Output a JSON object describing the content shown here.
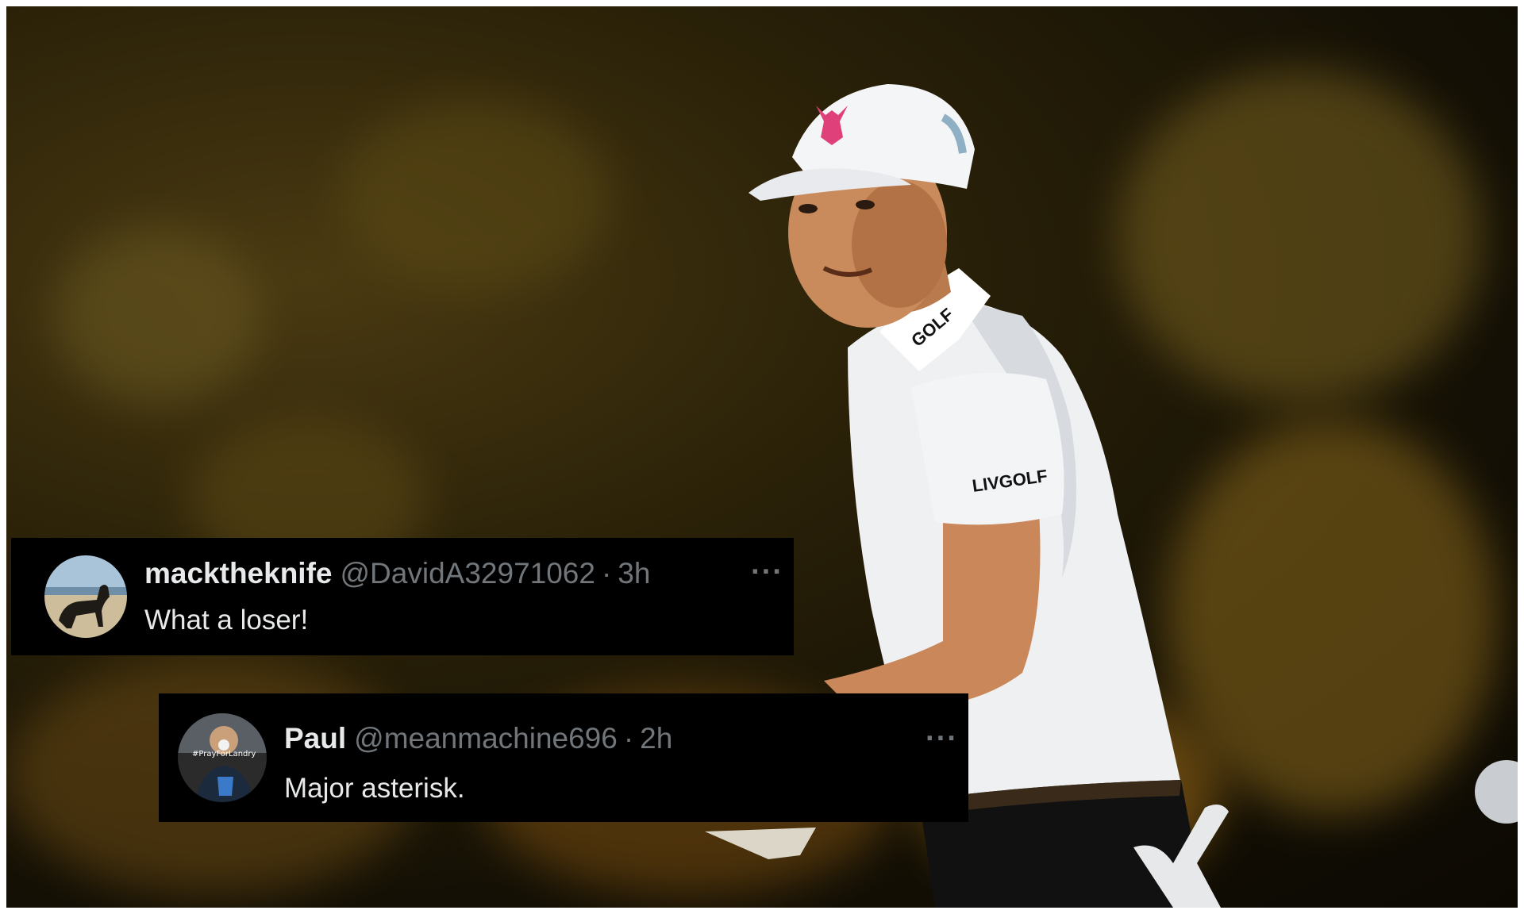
{
  "tweets": [
    {
      "display_name": "macktheknife",
      "handle": "@DavidA32971062",
      "separator": "·",
      "time": "3h",
      "more_icon": "···",
      "text": "What a loser!",
      "avatar_icon": "dog-on-beach-avatar"
    },
    {
      "display_name": "Paul",
      "handle": "@meanmachine696",
      "separator": "·",
      "time": "2h",
      "more_icon": "···",
      "text": "Major asterisk.",
      "avatar_icon": "person-avatar",
      "avatar_text": "#PrayForLandry"
    }
  ],
  "photo": {
    "cap_logo": "goat-logo",
    "collar_text": "GOLF",
    "sleeve_text": "LIVGOLF"
  },
  "colors": {
    "tweet_bg": "#000000",
    "name_text": "#e7e9ea",
    "meta_text": "#71767b",
    "cap_logo": "#e0407a"
  }
}
